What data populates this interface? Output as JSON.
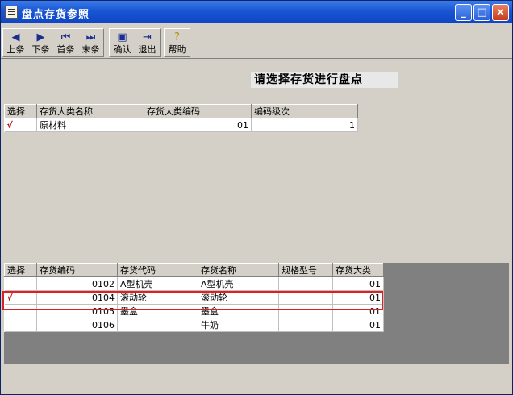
{
  "window": {
    "title": "盘点存货参照"
  },
  "titlebar_buttons": {
    "minimize": "_",
    "maximize": "□",
    "close": "×"
  },
  "toolbar": {
    "prev": "上条",
    "next": "下条",
    "first": "首条",
    "last": "末条",
    "confirm": "确认",
    "exit": "退出",
    "help": "帮助"
  },
  "prompt": "请选择存货进行盘点",
  "categories": {
    "headers": [
      "选择",
      "存货大类名称",
      "存货大类编码",
      "编码级次"
    ],
    "rows": [
      {
        "select": "√",
        "name": "原材料",
        "code": "01",
        "level": "1"
      }
    ]
  },
  "items": {
    "headers": [
      "选择",
      "存货编码",
      "存货代码",
      "存货名称",
      "规格型号",
      "存货大类"
    ],
    "rows": [
      {
        "select": "",
        "code": "0102",
        "alias": "A型机壳",
        "name": "A型机壳",
        "spec": "",
        "category": "01"
      },
      {
        "select": "√",
        "code": "0104",
        "alias": "滚动轮",
        "name": "滚动轮",
        "spec": "",
        "category": "01"
      },
      {
        "select": "",
        "code": "0105",
        "alias": "墨盒",
        "name": "墨盒",
        "spec": "",
        "category": "01"
      },
      {
        "select": "",
        "code": "0106",
        "alias": "",
        "name": "牛奶",
        "spec": "",
        "category": "01"
      }
    ]
  },
  "colors": {
    "titlebar": "#1956d4",
    "highlight": "#e02020",
    "check": "#c00000"
  }
}
